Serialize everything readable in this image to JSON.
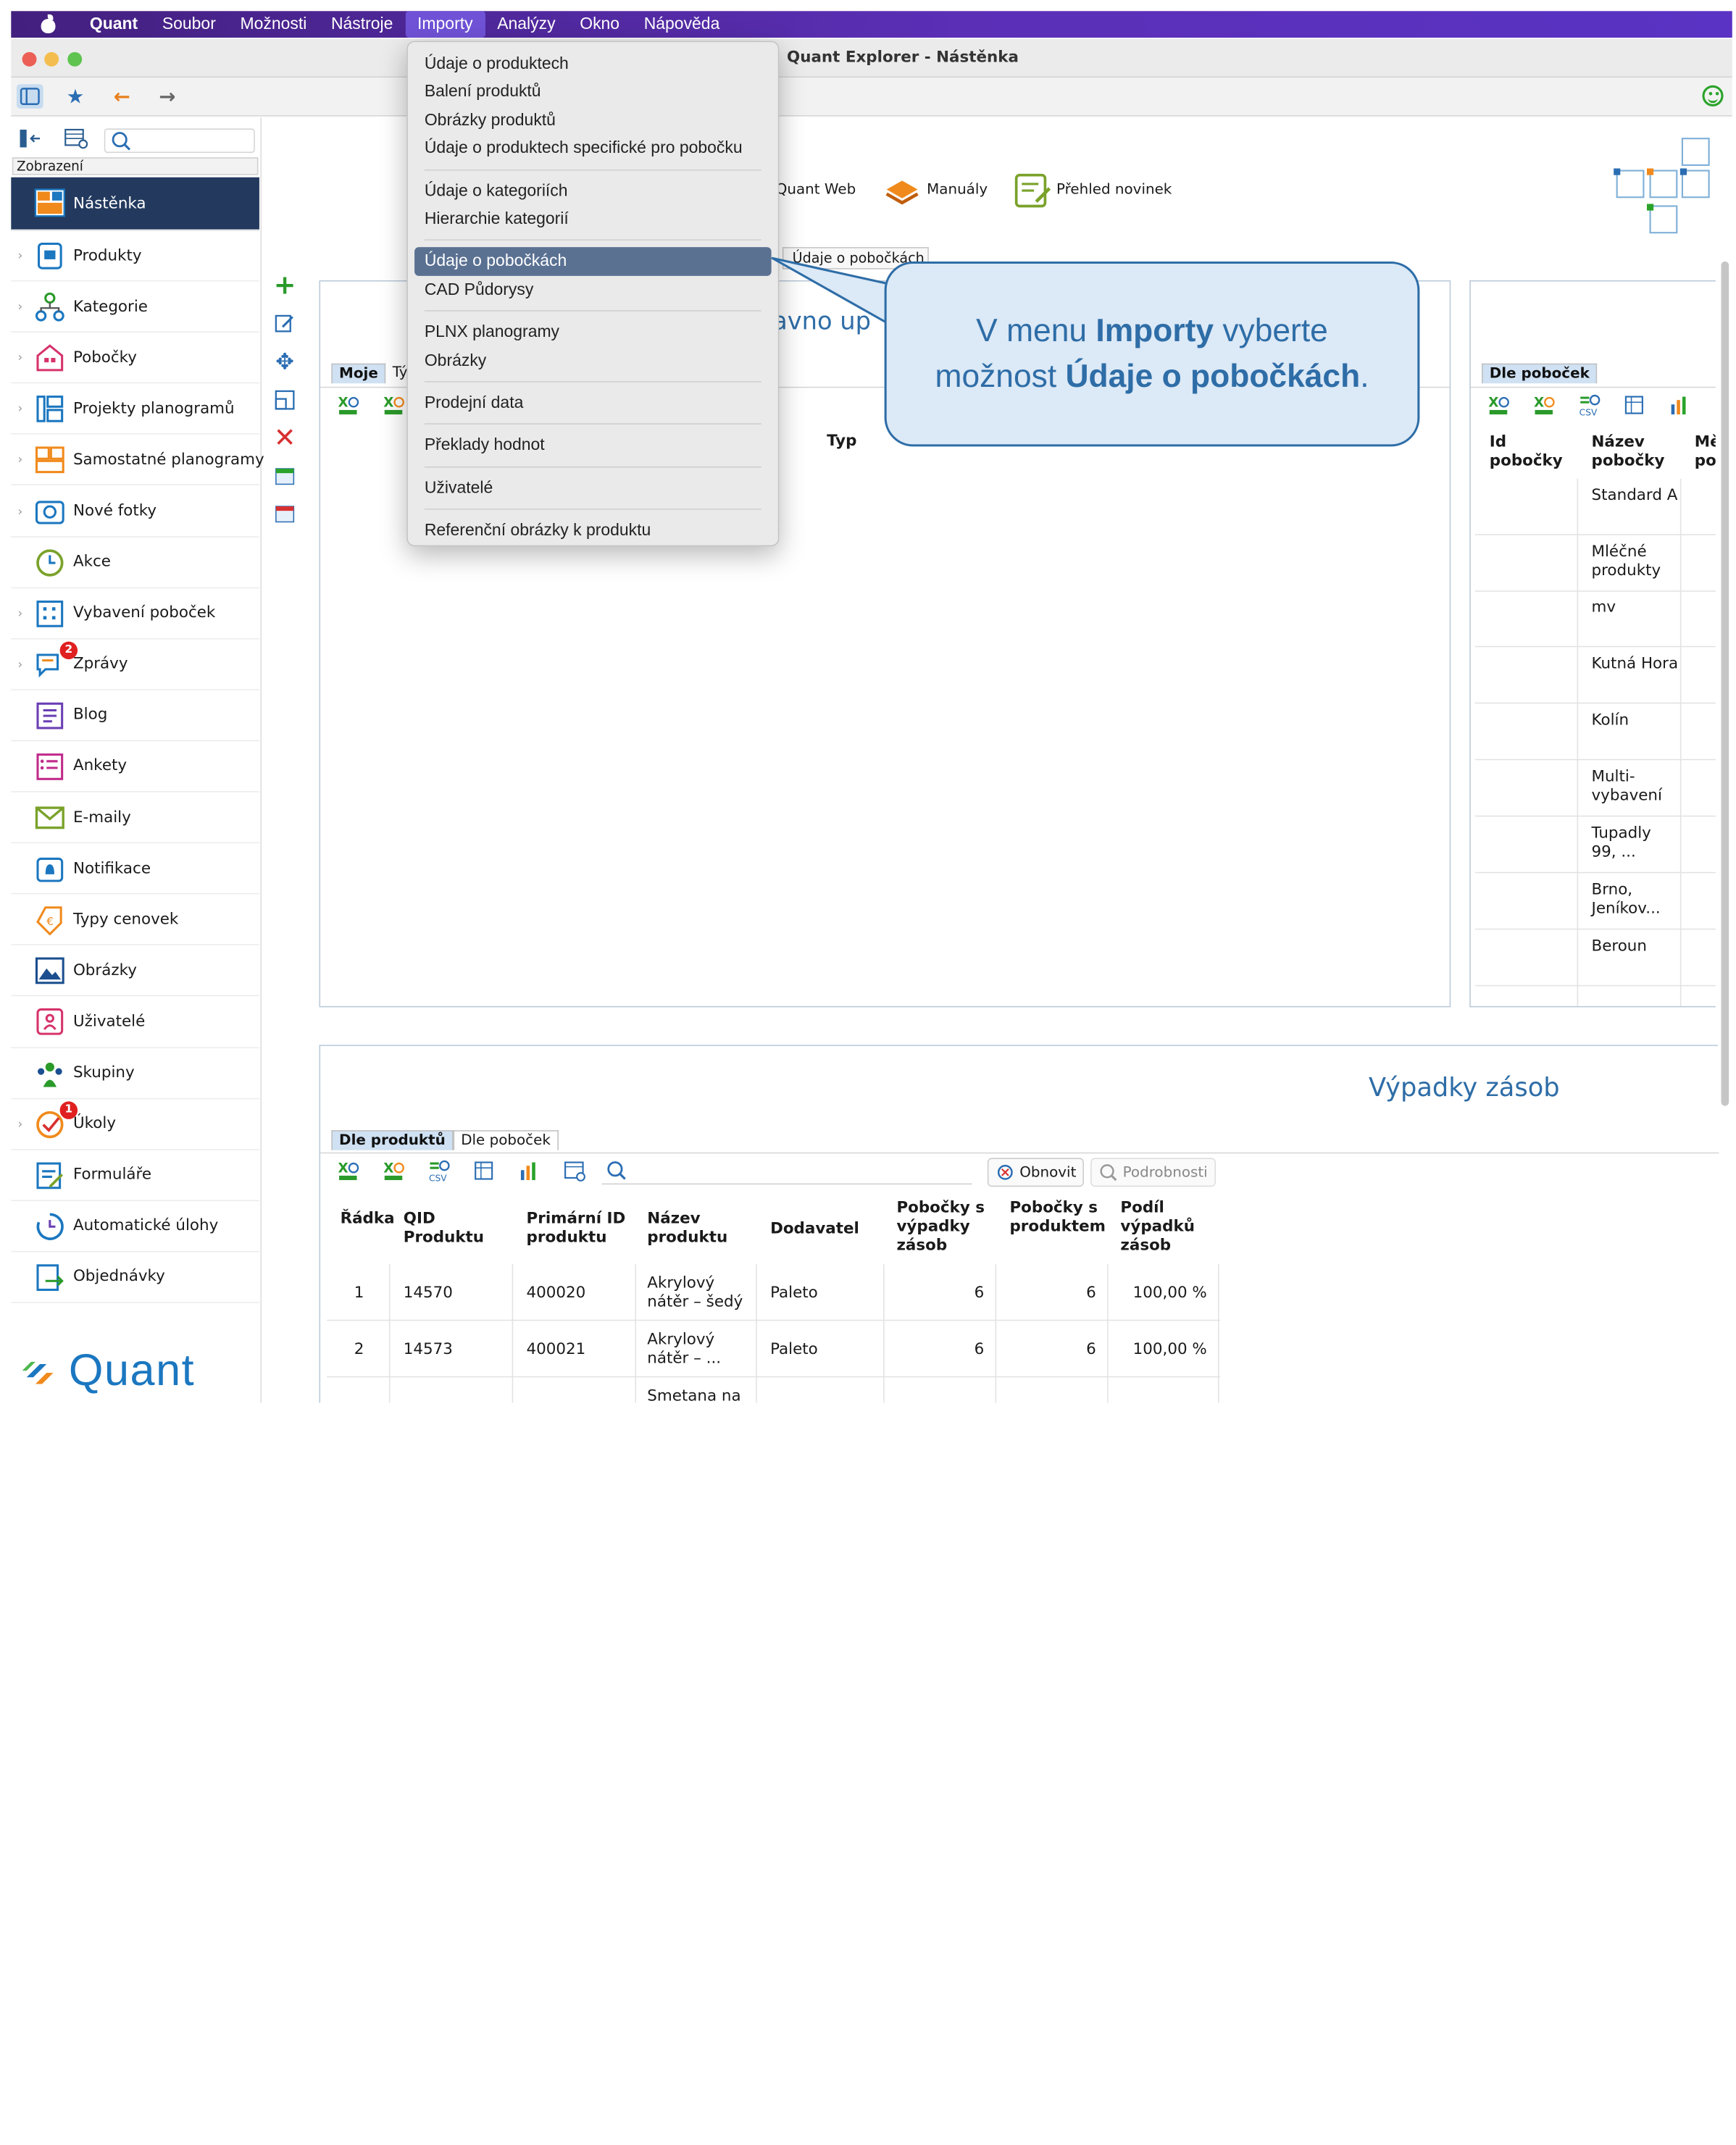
{
  "menubar": {
    "app": "Quant",
    "items": [
      "Soubor",
      "Možnosti",
      "Nástroje",
      "Importy",
      "Analýzy",
      "Okno",
      "Nápověda"
    ]
  },
  "window": {
    "title": "Quant Explorer - Nástěnka"
  },
  "sidebar": {
    "section": "Zobrazení",
    "items": [
      {
        "label": "Nástěnka",
        "icon": "dashboard-icon",
        "chevron": false
      },
      {
        "label": "Produkty",
        "icon": "product-icon",
        "chevron": true
      },
      {
        "label": "Kategorie",
        "icon": "category-tree-icon",
        "chevron": true
      },
      {
        "label": "Pobočky",
        "icon": "store-icon",
        "chevron": true
      },
      {
        "label": "Projekty planogramů",
        "icon": "planogram-project-icon",
        "chevron": true
      },
      {
        "label": "Samostatné planogramy",
        "icon": "planogram-icon",
        "chevron": true
      },
      {
        "label": "Nové fotky",
        "icon": "camera-icon",
        "chevron": true
      },
      {
        "label": "Akce",
        "icon": "clock-icon",
        "chevron": false
      },
      {
        "label": "Vybavení poboček",
        "icon": "fixtures-icon",
        "chevron": true
      },
      {
        "label": "Zprávy",
        "icon": "messages-icon",
        "chevron": true,
        "badge": "2"
      },
      {
        "label": "Blog",
        "icon": "blog-icon",
        "chevron": false
      },
      {
        "label": "Ankety",
        "icon": "survey-icon",
        "chevron": false
      },
      {
        "label": "E-maily",
        "icon": "email-icon",
        "chevron": false
      },
      {
        "label": "Notifikace",
        "icon": "notification-icon",
        "chevron": false
      },
      {
        "label": "Typy cenovek",
        "icon": "price-tag-icon",
        "chevron": false
      },
      {
        "label": "Obrázky",
        "icon": "image-icon",
        "chevron": false
      },
      {
        "label": "Uživatelé",
        "icon": "user-icon",
        "chevron": false
      },
      {
        "label": "Skupiny",
        "icon": "group-icon",
        "chevron": false
      },
      {
        "label": "Úkoly",
        "icon": "task-icon",
        "chevron": true,
        "badge": "1"
      },
      {
        "label": "Formuláře",
        "icon": "form-icon",
        "chevron": false
      },
      {
        "label": "Automatické úlohy",
        "icon": "auto-task-icon",
        "chevron": false
      },
      {
        "label": "Objednávky",
        "icon": "order-icon",
        "chevron": false
      }
    ],
    "logo": "Quant"
  },
  "dropdown": {
    "groups": [
      [
        "Údaje o produktech",
        "Balení produktů",
        "Obrázky produktů",
        "Údaje o produktech specifické pro pobočku"
      ],
      [
        "Údaje o kategoriích",
        "Hierarchie kategorií"
      ],
      [
        "Údaje o pobočkách",
        "CAD Půdorysy"
      ],
      [
        "PLNX planogramy",
        "Obrázky"
      ],
      [
        "Prodejní data"
      ],
      [
        "Překlady hodnot"
      ],
      [
        "Uživatelé"
      ],
      [
        "Referenční obrázky k produktu"
      ]
    ],
    "highlighted": "Údaje o pobočkách"
  },
  "tooltip": "Údaje o pobočkách",
  "callout": {
    "line1_pre": "V menu ",
    "line1_bold": "Importy",
    "line1_post": " vyberte",
    "line2_pre": "možnost ",
    "line2_bold": "Údaje o pobočkách",
    "line2_post": "."
  },
  "links": [
    {
      "label": "Quant Web",
      "icon": "web-icon"
    },
    {
      "label": "Manuály",
      "icon": "manuals-icon"
    },
    {
      "label": "Přehled novinek",
      "icon": "news-icon"
    }
  ],
  "recent_panel": {
    "title_fragment": "avno up",
    "tabs": [
      "Moje",
      "Tý"
    ],
    "column_typ": "Typ"
  },
  "stores_panel": {
    "tab": "Dle poboček",
    "columns": [
      "Id pobočky",
      "Název pobočky",
      "Mě po"
    ],
    "rows": [
      "Standard A",
      "Mléčné produkty",
      "mv",
      "Kutná Hora",
      "Kolín",
      "Multi-vybavení",
      "Tupadly 99, ...",
      "Brno, Jeníkov...",
      "Beroun"
    ]
  },
  "stockouts": {
    "title": "Výpadky zásob",
    "tabs": [
      "Dle produktů",
      "Dle poboček"
    ],
    "refresh": "Obnovit",
    "details": "Podrobnosti",
    "columns": [
      "Řádka",
      "QID Produktu",
      "Primární ID produktu",
      "Název produktu",
      "Dodavatel",
      "Pobočky s výpadky zásob",
      "Pobočky s produktem",
      "Podíl výpadků zásob"
    ],
    "rows": [
      {
        "rank": "1",
        "qid": "14570",
        "primary": "400020",
        "name": "Akrylový nátěr – šedý",
        "supplier": "Paleto",
        "out": "6",
        "with": "6",
        "share": "100,00 %"
      },
      {
        "rank": "2",
        "qid": "14573",
        "primary": "400021",
        "name": "Akrylový nátěr – ...",
        "supplier": "Paleto",
        "out": "6",
        "with": "6",
        "share": "100,00 %"
      },
      {
        "rank": "",
        "qid": "",
        "primary": "",
        "name": "Smetana na ...",
        "supplier": "",
        "out": "",
        "with": "",
        "share": ""
      }
    ]
  },
  "colors": {
    "accent": "#2e6da7",
    "menubar": "#4a2590",
    "selected_nav": "#233a5e",
    "highlight": "#5a7192"
  }
}
